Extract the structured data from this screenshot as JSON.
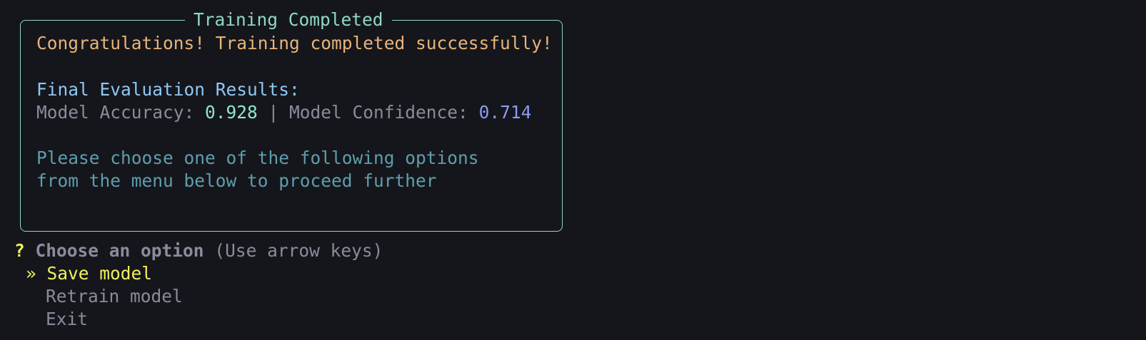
{
  "panel": {
    "title": "Training Completed",
    "congrats": "Congratulations! Training completed successfully!",
    "results_header": "Final Evaluation Results:",
    "accuracy_label": "Model Accuracy: ",
    "accuracy_value": "0.928",
    "separator": " | ",
    "confidence_label": "Model Confidence: ",
    "confidence_value": "0.714",
    "instruction_line1": "Please choose one of the following options",
    "instruction_line2": "from the menu below to proceed further"
  },
  "prompt": {
    "marker": "?",
    "question": "Choose an option",
    "hint": "(Use arrow keys)",
    "pointer": "»",
    "options": [
      {
        "label": "Save model",
        "selected": true
      },
      {
        "label": "Retrain model",
        "selected": false
      },
      {
        "label": "Exit",
        "selected": false
      }
    ]
  },
  "colors": {
    "background": "#15161b",
    "border": "#8fd9c6",
    "highlight": "#f0f060",
    "accuracy": "#8fe6cf",
    "confidence": "#8c9bf5"
  }
}
